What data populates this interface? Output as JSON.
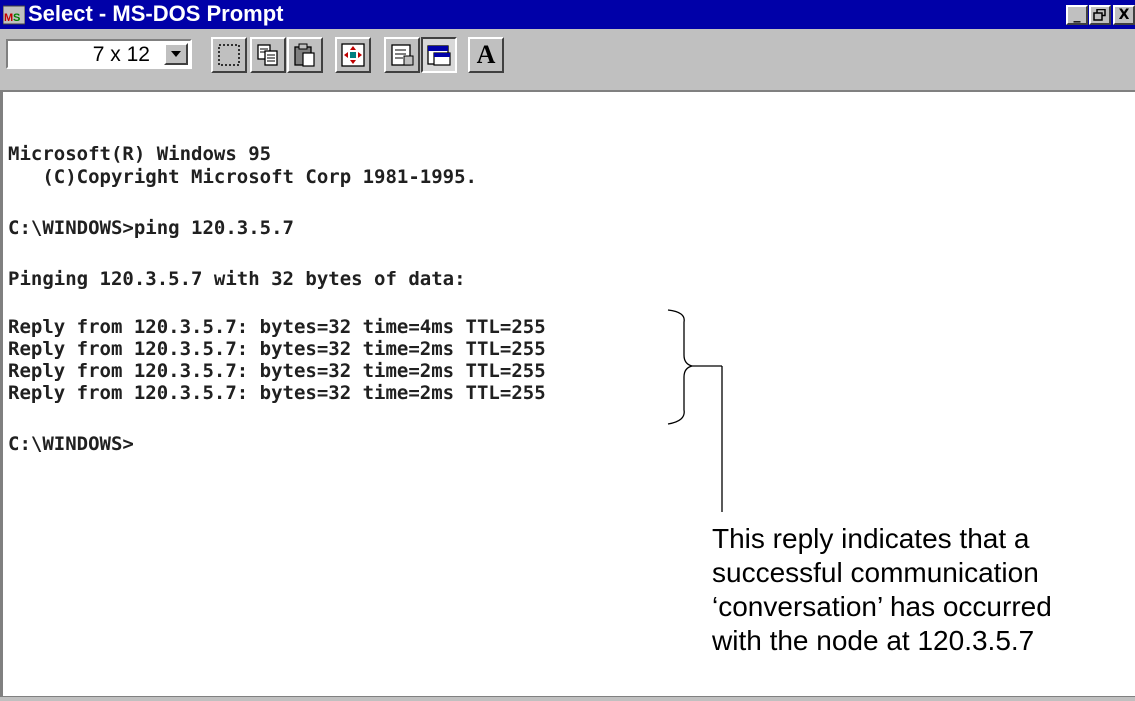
{
  "window": {
    "title": "Select - MS-DOS Prompt",
    "minimize_glyph": "_",
    "maximize_glyph": "▫",
    "close_glyph": "X"
  },
  "toolbar": {
    "font_size": "7 x 12",
    "buttons": [
      "mark-icon",
      "copy-icon",
      "paste-icon",
      "fullscreen-icon",
      "properties-icon",
      "background-icon",
      "font-icon"
    ],
    "font_button_label": "A"
  },
  "console": {
    "lines": [
      "Microsoft(R) Windows 95",
      "   (C)Copyright Microsoft Corp 1981-1995.",
      "",
      "C:\\WINDOWS>ping 120.3.5.7",
      "",
      "Pinging 120.3.5.7 with 32 bytes of data:",
      "",
      "Reply from 120.3.5.7: bytes=32 time=4ms TTL=255",
      "Reply from 120.3.5.7: bytes=32 time=2ms TTL=255",
      "Reply from 120.3.5.7: bytes=32 time=2ms TTL=255",
      "Reply from 120.3.5.7: bytes=32 time=2ms TTL=255",
      "",
      "C:\\WINDOWS>"
    ]
  },
  "annotation": {
    "lines": [
      "This reply indicates that a",
      "successful communication",
      "‘conversation’ has occurred",
      "with the node at 120.3.5.7"
    ]
  },
  "colors": {
    "titlebar": "#0000a8",
    "face": "#c0c0c0"
  }
}
